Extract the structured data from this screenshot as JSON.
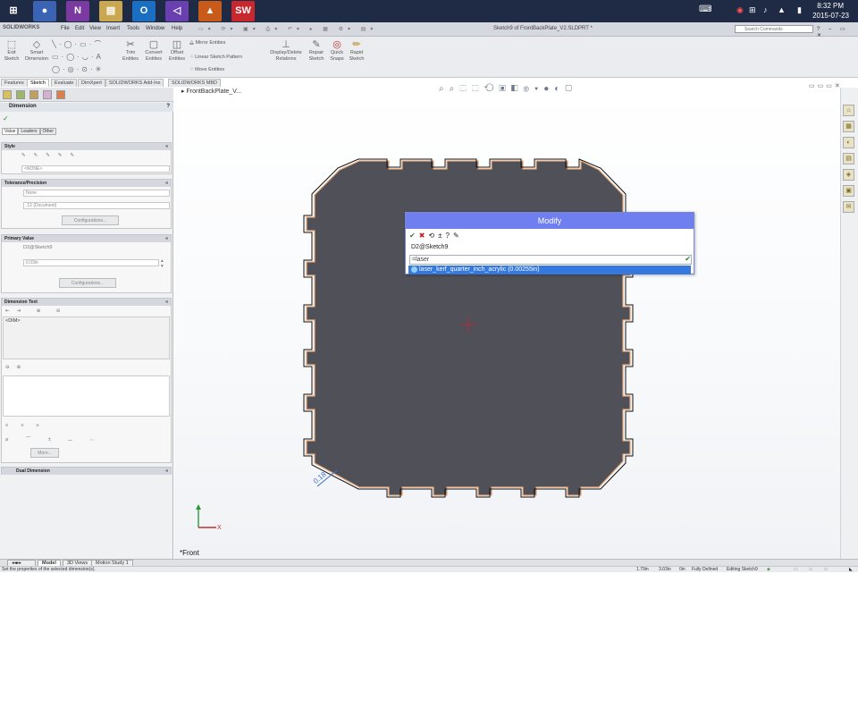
{
  "taskbar": {
    "apps": [
      {
        "icon": "windows-start-icon",
        "color": "#1f2a44",
        "glyph": "⊞"
      },
      {
        "icon": "chrome-icon",
        "color": "#4a77d4",
        "glyph": "●"
      },
      {
        "icon": "onenote-icon",
        "color": "#7a3aa0",
        "glyph": "N"
      },
      {
        "icon": "file-explorer-icon",
        "color": "#d6b35a",
        "glyph": "▤"
      },
      {
        "icon": "outlook-icon",
        "color": "#1a6fc2",
        "glyph": "O"
      },
      {
        "icon": "visual-studio-icon",
        "color": "#6a3fb0",
        "glyph": "◁"
      },
      {
        "icon": "matlab-icon",
        "color": "#d06020",
        "glyph": "▲"
      },
      {
        "icon": "solidworks-icon",
        "color": "#c8282d",
        "glyph": "SW"
      }
    ],
    "time": "8:32 PM",
    "date": "2015-07-23"
  },
  "titlebar": {
    "logo": "SOLIDWORKS",
    "menus": [
      "File",
      "Edit",
      "View",
      "Insert",
      "Tools",
      "Window",
      "Help"
    ],
    "document_title": "Sketch9 of FrontBackPlate_V2.SLDPRT *",
    "search_placeholder": "Search Commands"
  },
  "commands": {
    "exit_sketch": "Exit Sketch",
    "smart_dimension": "Smart Dimension",
    "trim_entities": "Trim Entities",
    "convert_entities": "Convert Entities",
    "offset_entities": "Offset Entities",
    "mirror_entities": "Mirror Entities",
    "linear_sketch_pattern": "Linear Sketch Pattern",
    "move_entities": "Move Entities",
    "display_delete_relations": "Display/Delete Relations",
    "repair_sketch": "Repair Sketch",
    "quick_snaps": "Quick Snaps",
    "rapid_sketch": "Rapid Sketch"
  },
  "cm_tabs": [
    "Features",
    "Sketch",
    "Evaluate",
    "DimXpert",
    "SOLIDWORKS Add-Ins",
    "SOLIDWORKS MBD"
  ],
  "property_manager": {
    "title": "Dimension",
    "tabs": [
      "Value",
      "Leaders",
      "Other"
    ],
    "style_section": "Style",
    "style_value": "<NONE>",
    "tolerance_section": "Tolerance/Precision",
    "tolerance_type": "None",
    "precision": ".12 (Document)",
    "config_button": "Configurations...",
    "primary_section": "Primary Value",
    "primary_name": "D2@Sketch9",
    "primary_value": "0.03in",
    "dimension_text_section": "Dimension Text",
    "dim_text_value": "<DIM>",
    "more_button": "More...",
    "dual_section": "Dual Dimension"
  },
  "graphics": {
    "part_name": "FrontBackPlate_V...",
    "view_label": "*Front",
    "dimension_label": "0.18"
  },
  "modify_dialog": {
    "title": "Modify",
    "dim_name": "D2@Sketch9",
    "input_value": "=laser",
    "suggestion": "laser_kerf_quarter_inch_acrylic (0.00255in)"
  },
  "bottom_tabs": [
    "Model",
    "3D Views",
    "Motion Study 1"
  ],
  "status": {
    "message": "Set the properties of the selected dimension(s).",
    "x": "1.79in",
    "y": "3.03in",
    "z": "0in",
    "state": "Fully Defined",
    "mode": "Editing Sketch9"
  }
}
